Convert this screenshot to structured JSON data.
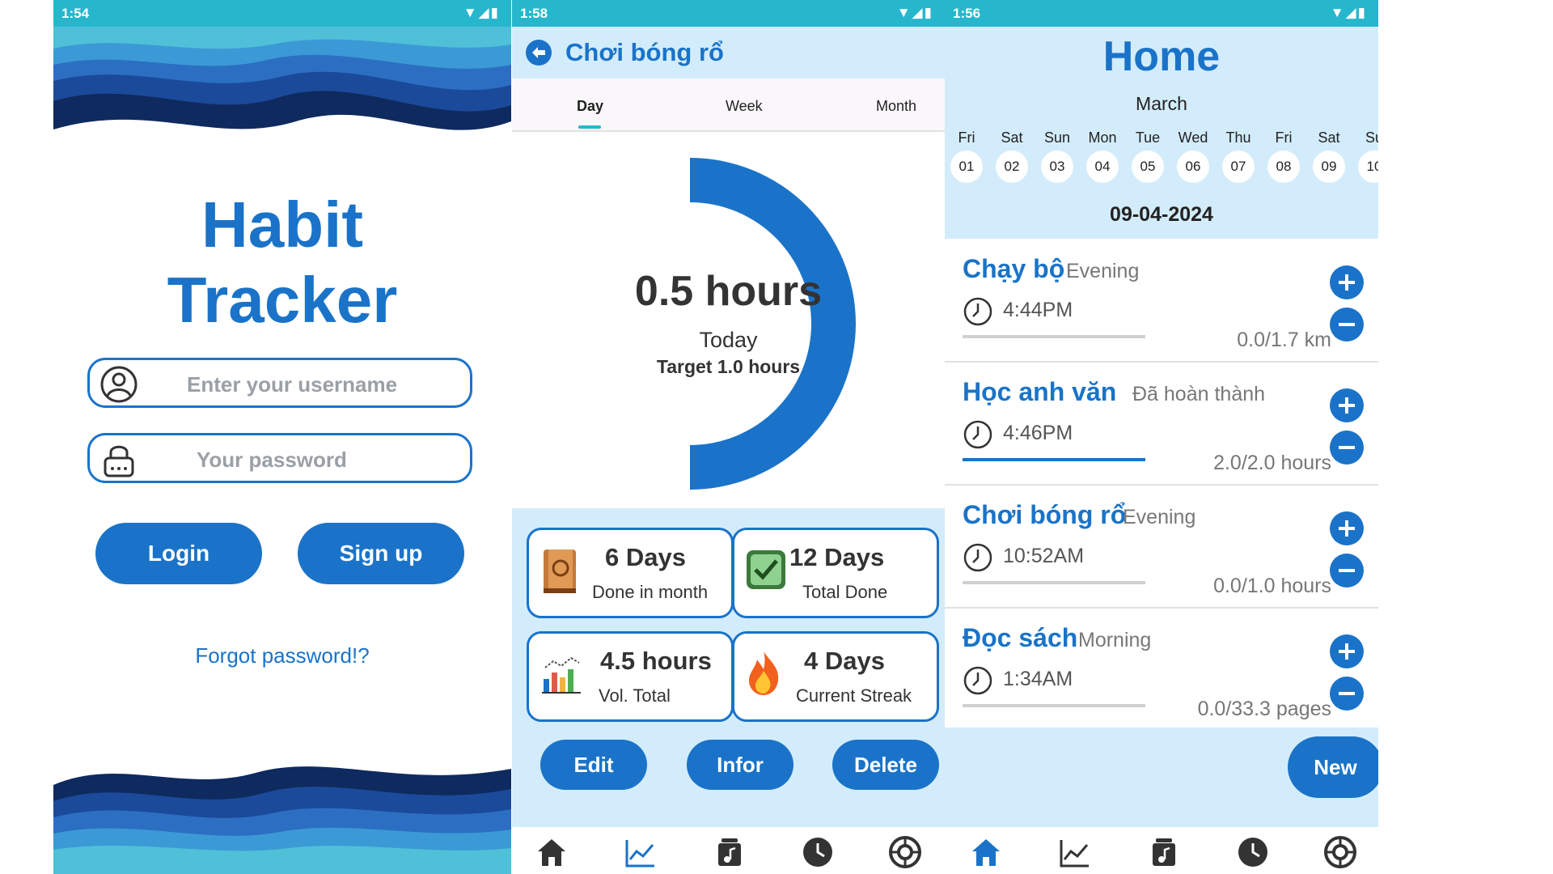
{
  "login": {
    "status_time": "1:54",
    "title_line1": "Habit",
    "title_line2": "Tracker",
    "username_placeholder": "Enter your username",
    "password_placeholder": "Your password",
    "login_label": "Login",
    "signup_label": "Sign up",
    "forgot_label": "Forgot password!?"
  },
  "detail": {
    "status_time": "1:58",
    "title": "Chơi bóng rổ",
    "tabs": [
      "Day",
      "Week",
      "Month"
    ],
    "active_tab": "Day",
    "progress_value": "0.5 hours",
    "progress_caption": "Today",
    "progress_target": "Target 1.0 hours",
    "progress_fraction": 0.5,
    "stats": [
      {
        "value": "6 Days",
        "label": "Done in month",
        "icon": "notebook-icon"
      },
      {
        "value": "12 Days",
        "label": "Total Done",
        "icon": "checkbox-icon"
      },
      {
        "value": "4.5 hours",
        "label": "Vol. Total",
        "icon": "bar-chart-icon"
      },
      {
        "value": "4 Days",
        "label": "Current Streak",
        "icon": "fire-icon"
      }
    ],
    "edit_label": "Edit",
    "infor_label": "Infor",
    "delete_label": "Delete"
  },
  "home": {
    "status_time": "1:56",
    "title": "Home",
    "month": "March",
    "days_of_week": [
      "Fri",
      "Sat",
      "Sun",
      "Mon",
      "Tue",
      "Wed",
      "Thu",
      "Fri",
      "Sat",
      "Su"
    ],
    "days": [
      "01",
      "02",
      "03",
      "04",
      "05",
      "06",
      "07",
      "08",
      "09",
      "10"
    ],
    "date": "09-04-2024",
    "habits": [
      {
        "name": "Chạy bộ",
        "tag": "Evening",
        "time": "4:44PM",
        "progress": "0.0/1.7 km",
        "fraction": 0.0
      },
      {
        "name": "Học anh văn",
        "tag": "Đã hoàn thành",
        "time": "4:46PM",
        "progress": "2.0/2.0 hours",
        "fraction": 1.0
      },
      {
        "name": "Chơi bóng rổ",
        "tag": "Evening",
        "time": "10:52AM",
        "progress": "0.0/1.0 hours",
        "fraction": 0.0
      },
      {
        "name": "Đọc sách",
        "tag": "Morning",
        "time": "1:34AM",
        "progress": "0.0/33.3 pages",
        "fraction": 0.0
      }
    ],
    "new_label": "New"
  },
  "nav_icons": [
    "home-icon",
    "chart-icon",
    "music-icon",
    "clock-icon",
    "settings-icon"
  ],
  "colors": {
    "primary": "#1a73c8",
    "status_bar": "#27b7cd",
    "panel": "#d3ecfb"
  }
}
